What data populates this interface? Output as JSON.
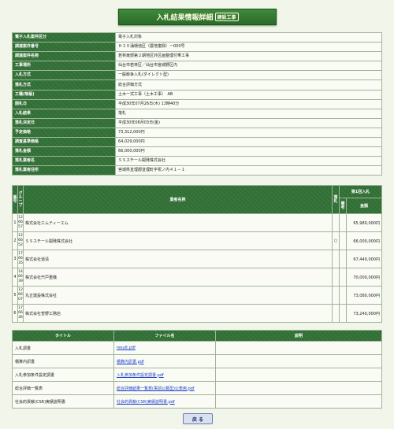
{
  "title": {
    "main": "入札結果情報詳細",
    "tag": "建設工事"
  },
  "info_rows": [
    {
      "label": "電子入札案件区分",
      "value": "電子入札対象"
    },
    {
      "label": "調達案件番号",
      "value": "Ｈ３０涌環他区（農地復興）ー000号"
    },
    {
      "label": "調達案件名称",
      "value": "若林東部第２期地区外区画整理付帯工事"
    },
    {
      "label": "工事場所",
      "value": "仙台市若林区／仙台市宮城野区内"
    },
    {
      "label": "入札方式",
      "value": "一般競争入札(ダイレクト型)"
    },
    {
      "label": "落札方式",
      "value": "総合評価方式"
    },
    {
      "label": "工種(等級)",
      "value": "土木一式工事（土木工事）　AB"
    },
    {
      "label": "開札日",
      "value": "平成30年07月26日(木) 13時40分"
    },
    {
      "label": "入札結果",
      "value": "落札"
    },
    {
      "label": "落札決定日",
      "value": "平成30年08月03日(金)"
    },
    {
      "label": "予定価格",
      "value": "73,312,000円"
    },
    {
      "label": "調査基準価格",
      "value": "64,029,000円"
    },
    {
      "label": "落札金額",
      "value": "66,000,000円"
    },
    {
      "label": "落札業者名",
      "value": "ＳＳスチール開発株式会社"
    },
    {
      "label": "落札業者住所",
      "value": "宮城県亘理郡亘理町字祝ノ内４１－１"
    }
  ],
  "bids_header": {
    "no": "番号",
    "group": "グループ",
    "name": "業者名称",
    "flag": "落札",
    "note": "備考",
    "first_round": "第1回入札",
    "amount": "金額"
  },
  "bids": [
    {
      "no": "1",
      "group": [
        "12",
        "66",
        "57"
      ],
      "name": "株式会社エムティーエム",
      "flag": "",
      "amount": "65,980,000円"
    },
    {
      "no": "2",
      "group": [
        "12",
        "66",
        "52"
      ],
      "name": "ＳＳスチール開発株式会社",
      "flag": "○",
      "amount": "66,000,000円"
    },
    {
      "no": "3",
      "group": [
        "17",
        "66",
        "35"
      ],
      "name": "株式会社道清",
      "flag": "",
      "amount": "67,440,000円"
    },
    {
      "no": "4",
      "group": [
        "14",
        "66",
        "39"
      ],
      "name": "株式会社宍戸重機",
      "flag": "",
      "amount": "70,000,000円"
    },
    {
      "no": "5",
      "group": [
        "12",
        "66",
        "07"
      ],
      "name": "丸正建設株式会社",
      "flag": "",
      "amount": "73,080,000円"
    },
    {
      "no": "6",
      "group": [
        "17",
        "66",
        "36"
      ],
      "name": "株式会社菅野工務店",
      "flag": "",
      "amount": "73,240,000円"
    }
  ],
  "docs_header": {
    "title": "タイトル",
    "file": "ファイル名",
    "desc": "説明"
  },
  "docs": [
    {
      "title": "入札調書",
      "file": "result.pdf"
    },
    {
      "title": "積算内訳書",
      "file": "積算内訳書.pdf"
    },
    {
      "title": "入札参加条件設定調書",
      "file": "入札参加条件設定調書.pdf"
    },
    {
      "title": "総合評価一覧表",
      "file": "総合評価結果一覧表(事前公募型)公表用.pdf"
    },
    {
      "title": "社会的貢献(CSR)実績説明書",
      "file": "社会的貢献(CSR)実績説明書.pdf"
    }
  ],
  "back_button": "戻 る"
}
